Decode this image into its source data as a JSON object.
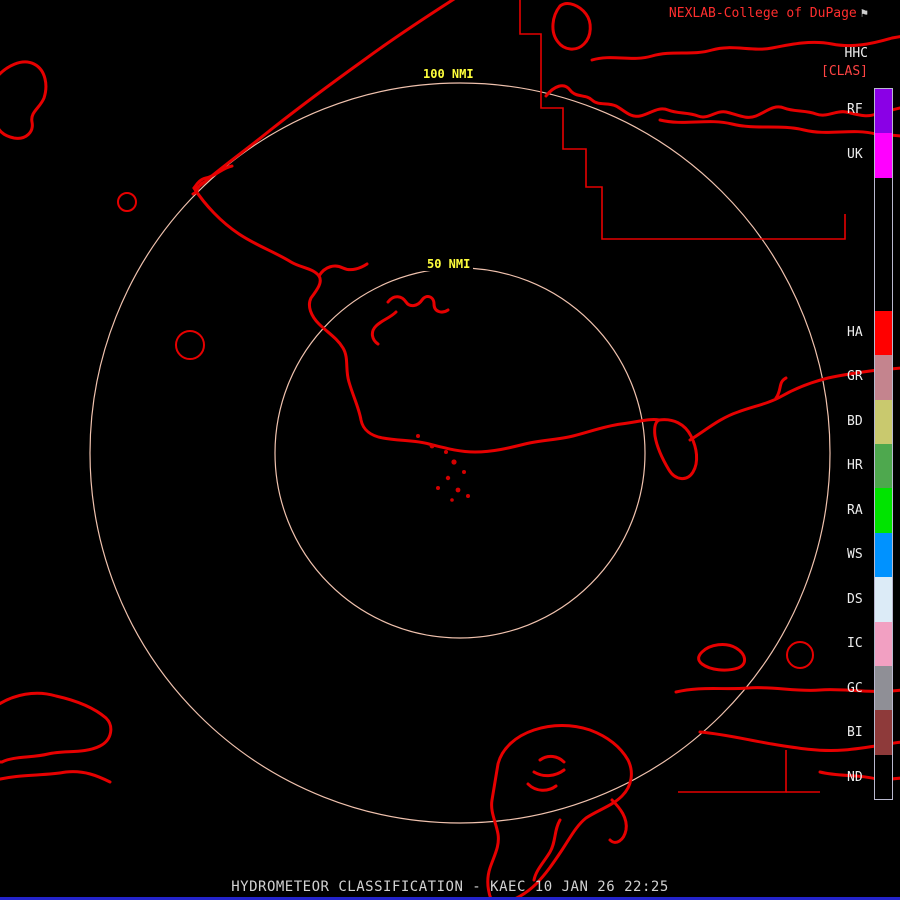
{
  "header": {
    "brand": "NEXLAB-College of DuPage",
    "logo_glyph": "⚑",
    "product_code": "HHC",
    "product_mode": "[CLAS]"
  },
  "rings": [
    {
      "label": "100 NMI"
    },
    {
      "label": "50 NMI"
    }
  ],
  "colorbar": {
    "segments": [
      {
        "label": "RF",
        "color": "#8a00e6"
      },
      {
        "label": "UK",
        "color": "#ff00ff"
      },
      {
        "label": "",
        "color": "#000000"
      },
      {
        "label": "",
        "color": "#000000"
      },
      {
        "label": "",
        "color": "#000000"
      },
      {
        "label": "HA",
        "color": "#ff0000"
      },
      {
        "label": "GR",
        "color": "#c4848e"
      },
      {
        "label": "BD",
        "color": "#c9c96e"
      },
      {
        "label": "HR",
        "color": "#4ea84e"
      },
      {
        "label": "RA",
        "color": "#00e400"
      },
      {
        "label": "WS",
        "color": "#0092ff"
      },
      {
        "label": "DS",
        "color": "#dcebf7"
      },
      {
        "label": "IC",
        "color": "#f2a0c2"
      },
      {
        "label": "GC",
        "color": "#8f8f96"
      },
      {
        "label": "BI",
        "color": "#8e3a3a"
      },
      {
        "label": "ND",
        "color": "#000000"
      }
    ]
  },
  "footer": {
    "title": "HYDROMETEOR CLASSIFICATION - KAEC 10 JAN 26 22:25"
  },
  "colors": {
    "map_outline": "#e60000",
    "range_ring": "#f0c2ae",
    "ring_label": "#ffff3c",
    "brand_text": "#ff2e2e",
    "footer_bar": "#2424cc"
  }
}
